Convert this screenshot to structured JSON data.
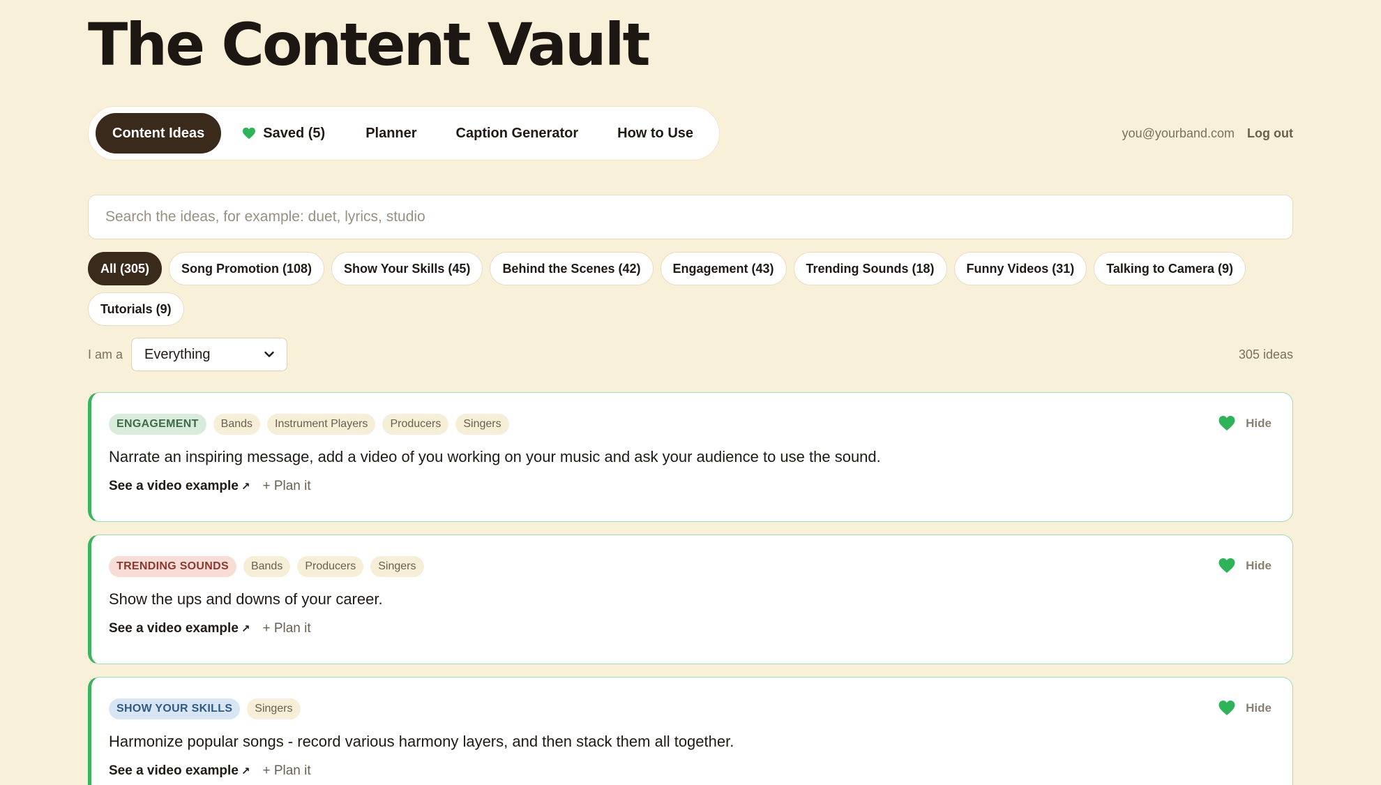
{
  "title": "The Content Vault",
  "nav": {
    "tabs": [
      {
        "label": "Content Ideas",
        "active": true
      },
      {
        "label": "Saved (5)",
        "icon": "heart-icon"
      },
      {
        "label": "Planner"
      },
      {
        "label": "Caption Generator"
      },
      {
        "label": "How to Use"
      }
    ]
  },
  "user": {
    "email": "you@yourband.com",
    "logout": "Log out"
  },
  "search": {
    "placeholder": "Search the ideas, for example: duet, lyrics, studio",
    "value": ""
  },
  "filters": [
    {
      "label": "All (305)",
      "active": true
    },
    {
      "label": "Song Promotion (108)"
    },
    {
      "label": "Show Your Skills (45)"
    },
    {
      "label": "Behind the Scenes (42)"
    },
    {
      "label": "Engagement (43)"
    },
    {
      "label": "Trending Sounds (18)"
    },
    {
      "label": "Funny Videos (31)"
    },
    {
      "label": "Talking to Camera (9)"
    },
    {
      "label": "Tutorials (9)"
    }
  ],
  "role": {
    "label": "I am a",
    "selected": "Everything"
  },
  "count": "305 ideas",
  "colors": {
    "background": "#f8f0d8",
    "accent_dark": "#3a2a1b",
    "saved_green": "#2eb35a",
    "card_border": "#9fdcb3"
  },
  "cards": [
    {
      "category": "ENGAGEMENT",
      "category_style": "engagement",
      "tags": [
        "Bands",
        "Instrument Players",
        "Producers",
        "Singers"
      ],
      "text": "Narrate an inspiring message, add a video of you working on your music and ask your audience to use the sound.",
      "video_link": "See a video example",
      "plan_link": "+ Plan it",
      "hide": "Hide"
    },
    {
      "category": "TRENDING SOUNDS",
      "category_style": "trending",
      "tags": [
        "Bands",
        "Producers",
        "Singers"
      ],
      "text": "Show the ups and downs of your career.",
      "video_link": "See a video example",
      "plan_link": "+ Plan it",
      "hide": "Hide"
    },
    {
      "category": "SHOW YOUR SKILLS",
      "category_style": "skills",
      "tags": [
        "Singers"
      ],
      "text": "Harmonize popular songs - record various harmony layers, and then stack them all together.",
      "video_link": "See a video example",
      "plan_link": "+ Plan it",
      "hide": "Hide"
    }
  ]
}
